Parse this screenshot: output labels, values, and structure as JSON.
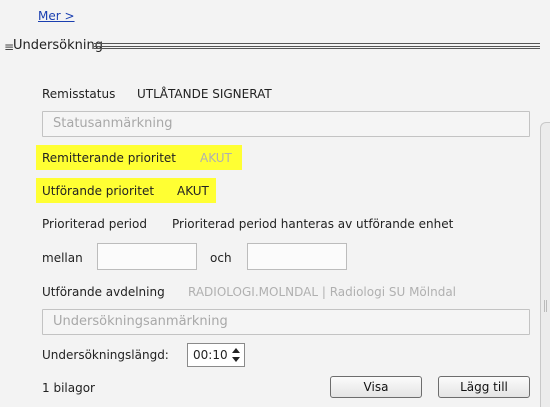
{
  "more_link": "Mer >",
  "section": {
    "title": "Undersökning"
  },
  "remisstatus": {
    "label": "Remisstatus",
    "value": "UTLÅTANDE SIGNERAT"
  },
  "statusanmarkning": {
    "placeholder": "Statusanmärkning"
  },
  "remitterande": {
    "label": "Remitterande prioritet",
    "value": "AKUT"
  },
  "utforande": {
    "label": "Utförande prioritet",
    "value": "AKUT"
  },
  "prioriterad": {
    "label": "Prioriterad period",
    "value": "Prioriterad period hanteras av utförande enhet"
  },
  "period": {
    "from_label": "mellan",
    "to_label": "och",
    "from_value": "",
    "to_value": ""
  },
  "avdelning": {
    "label": "Utförande avdelning",
    "value": "RADIOLOGI.MOLNDAL | Radiologi SU Mölndal"
  },
  "undersokningsanmarkning": {
    "placeholder": "Undersökningsanmärkning"
  },
  "langd": {
    "label": "Undersökningslängd:",
    "value": "00:10"
  },
  "bilagor": {
    "count_label": "1 bilagor",
    "view_label": "Visa",
    "add_label": "Lägg till"
  },
  "colors": {
    "highlight": "#ffff33",
    "link": "#1a3fb0",
    "muted": "#b0b0b0"
  },
  "icons": {
    "hamburger": "hamburger-icon",
    "spinner_up": "chevron-up-icon",
    "spinner_down": "chevron-down-icon"
  }
}
